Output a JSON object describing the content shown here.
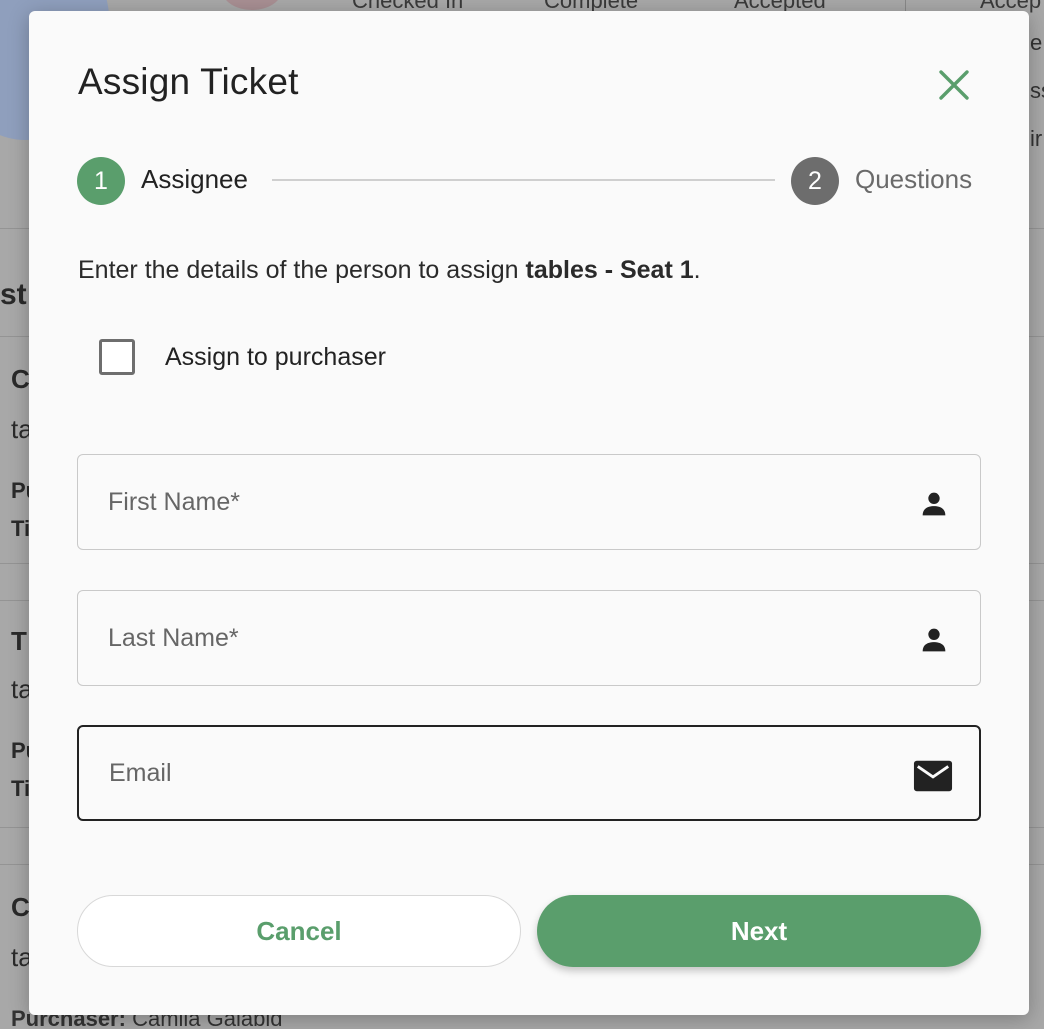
{
  "background": {
    "stats_headers": [
      "Checked In",
      "Complete",
      "Accepted",
      "Accep"
    ],
    "right_fragments": [
      "e",
      "ss",
      "ir"
    ],
    "left_heading_fragment": "st l",
    "left_row_fragments": [
      "C",
      "ta",
      "Pu",
      "Ti",
      "T",
      "ta",
      "Pu",
      "Ti",
      "C",
      "ta"
    ],
    "footer_label": "Purchaser:",
    "footer_value": "Camila Galabid"
  },
  "modal": {
    "title": "Assign Ticket",
    "close_icon": "close-icon",
    "stepper": {
      "steps": [
        {
          "number": "1",
          "label": "Assignee",
          "state": "active",
          "color": "#5a9e6c"
        },
        {
          "number": "2",
          "label": "Questions",
          "state": "inactive",
          "color": "#6d6d6d"
        }
      ]
    },
    "intro": {
      "prefix": "Enter the details of the person to assign ",
      "ticket_name": "tables - Seat 1",
      "suffix": "."
    },
    "assign_to_purchaser": {
      "label": "Assign to purchaser",
      "checked": false
    },
    "fields": {
      "first_name": {
        "placeholder": "First Name*",
        "value": "",
        "icon": "person-icon"
      },
      "last_name": {
        "placeholder": "Last Name*",
        "value": "",
        "icon": "person-icon"
      },
      "email": {
        "placeholder": "Email",
        "value": "",
        "icon": "mail-icon"
      }
    },
    "buttons": {
      "cancel_label": "Cancel",
      "next_label": "Next"
    }
  },
  "colors": {
    "accent": "#5a9e6c",
    "inactive_step": "#6d6d6d"
  }
}
